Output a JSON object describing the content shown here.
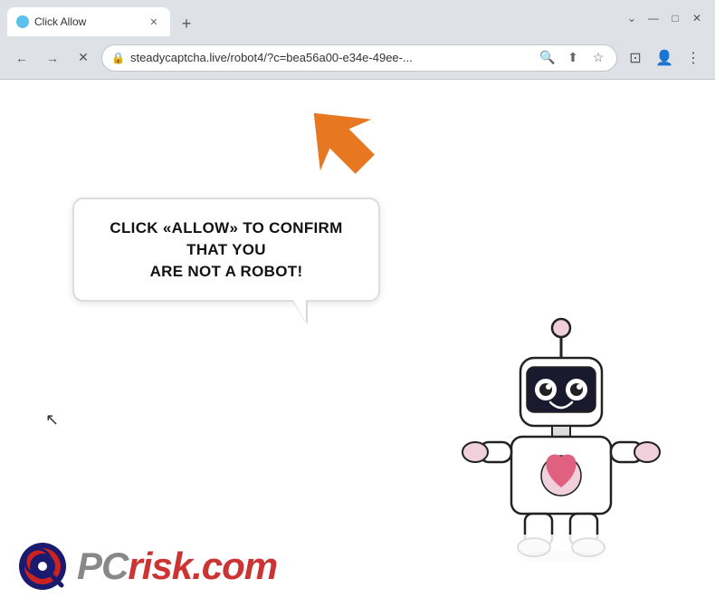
{
  "browser": {
    "tab": {
      "title": "Click Allow",
      "favicon_color": "#5bc0eb"
    },
    "new_tab_label": "+",
    "window_controls": {
      "minimize": "—",
      "maximize": "□",
      "close": "✕"
    },
    "nav": {
      "back_label": "←",
      "forward_label": "→",
      "reload_label": "✕",
      "address": "steadycaptcha.live/robot4/?c=bea56a00-e34e-49ee-...",
      "lock_icon": "🔒"
    },
    "address_icons": {
      "search": "🔍",
      "share": "↗",
      "star": "☆",
      "split": "⊡",
      "profile": "👤",
      "menu": "⋮"
    }
  },
  "page": {
    "bubble_text_line1": "CLICK «ALLOW» TO CONFIRM THAT YOU",
    "bubble_text_line2": "ARE NOT A ROBOT!",
    "arrow_color": "#e87722",
    "watermark": {
      "text": "PC",
      "dotcom": "risk.com"
    }
  }
}
